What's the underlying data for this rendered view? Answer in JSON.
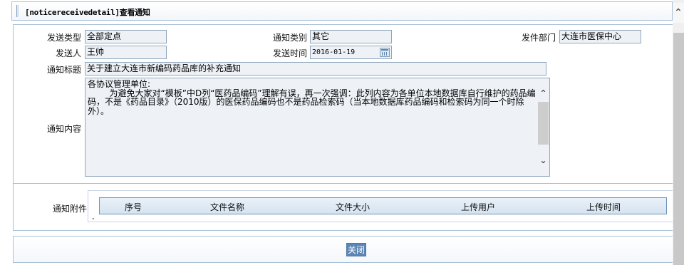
{
  "header": {
    "title": "[noticereceivedetail]查看通知"
  },
  "form": {
    "send_type_label": "发送类型",
    "send_type_value": "全部定点",
    "notice_category_label": "通知类别",
    "notice_category_value": "其它",
    "department_label": "发件部门",
    "department_value": "大连市医保中心",
    "sender_label": "发送人",
    "sender_value": "王帅",
    "send_time_label": "发送时间",
    "send_time_value": "2016-01-19",
    "subject_label": "通知标题",
    "subject_value": "关于建立大连市新编码药品库的补充通知",
    "content_label": "通知内容",
    "content_value": "各协议管理单位:\n        为避免大家对“模板”中D列“医药品编码”理解有误，再一次强调：此列内容为各单位本地数据库自行维护的药品编码，不是《药品目录》（2010版）的医保药品编码也不是药品检索码（当本地数据库药品编码和检索码为同一个时除外）。"
  },
  "attachments": {
    "label": "通知附件",
    "columns": [
      "序号",
      "文件名称",
      "文件大小",
      "上传用户",
      "上传时间"
    ],
    "rows": []
  },
  "buttons": {
    "close_label": "关闭"
  },
  "icons": {
    "calendar": "calendar-icon",
    "scroll_up": "chevron-up-icon",
    "scroll_down": "chevron-down-icon"
  },
  "colors": {
    "border": "#a9bfd6",
    "field_bg": "#eef2f7",
    "button_bg": "#5c86b5"
  }
}
